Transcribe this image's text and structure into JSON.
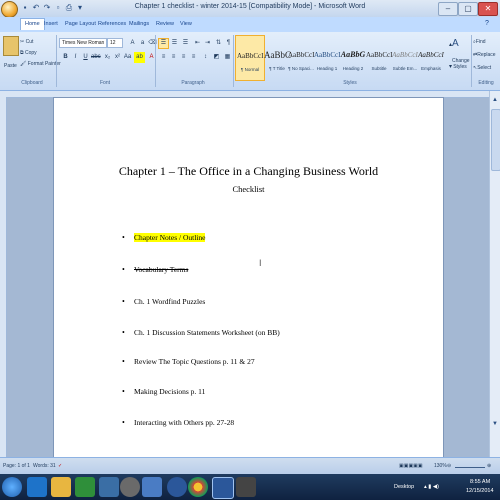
{
  "window": {
    "title": "Chapter 1 checklist - winter 2014-15 [Compatibility Mode] - Microsoft Word",
    "minimize": "–",
    "maximize": "▢",
    "close": "✕"
  },
  "ribbon": {
    "tabs": [
      "Home",
      "Insert",
      "Page Layout",
      "References",
      "Mailings",
      "Review",
      "View"
    ],
    "clipboard": {
      "paste": "Paste",
      "cut": "Cut",
      "copy": "Copy",
      "format_painter": "Format Painter",
      "label": "Clipboard"
    },
    "font": {
      "name": "Times New Roman",
      "size": "12",
      "label": "Font"
    },
    "paragraph": {
      "label": "Paragraph"
    },
    "styles": {
      "label": "Styles",
      "items": [
        {
          "sample": "AaBbCcI",
          "name": "¶ Normal"
        },
        {
          "sample": "AaBbC",
          "name": "¶ T Title"
        },
        {
          "sample": "AaBbCcI",
          "name": "¶ No Spaci..."
        },
        {
          "sample": "AaBbCcI",
          "name": "Heading 1"
        },
        {
          "sample": "AaBbG",
          "name": "Heading 2"
        },
        {
          "sample": "AaBbCcI",
          "name": "Subtitle"
        },
        {
          "sample": "AaBbCcI",
          "name": "Subtle Em..."
        },
        {
          "sample": "AaBbCcI",
          "name": "Emphasis"
        }
      ],
      "change_styles": "Change Styles"
    },
    "editing": {
      "find": "Find",
      "replace": "Replace",
      "select": "Select",
      "label": "Editing"
    }
  },
  "document": {
    "title": "Chapter 1 – The Office in a Changing Business World",
    "subtitle": "Checklist",
    "items": [
      {
        "text": "Chapter Notes / Outline"
      },
      {
        "text": "Vocabulary Terms"
      },
      {
        "text": "Ch. 1 Wordfind Puzzles"
      },
      {
        "text": "Ch. 1 Discussion Statements Worksheet (on BB)"
      },
      {
        "text": "Review The Topic Questions p. 11 & 27"
      },
      {
        "text": "Making Decisions p. 11"
      },
      {
        "text": "Interacting with Others pp. 27-28"
      }
    ]
  },
  "statusbar": {
    "page": "Page: 1 of 1",
    "words": "Words: 31",
    "zoom": "130%"
  },
  "taskbar": {
    "desktop": "Desktop",
    "time": "8:55 AM",
    "date": "12/15/2014"
  },
  "colors": {
    "highlight": "#ffff00",
    "ribbon": "#c7daf3",
    "taskbar": "#0f2240"
  }
}
